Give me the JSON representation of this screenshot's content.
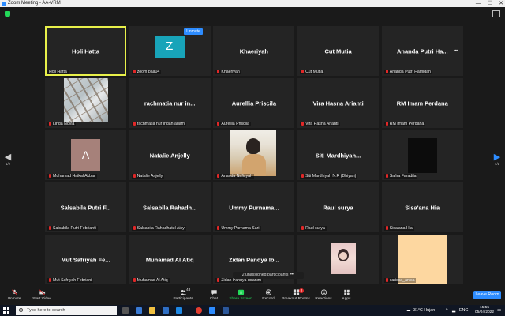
{
  "window": {
    "title": "Zoom Meeting - AA-VRM",
    "minimize": "—",
    "maximize": "☐",
    "close": "✕"
  },
  "security_icon": "shield-icon",
  "view_icon": "grid-view-icon",
  "tiles": [
    {
      "big": "Holi Hatta",
      "label": "Holi Hatta",
      "muted": false,
      "media": "none",
      "active": true
    },
    {
      "big": "",
      "label": "zoom baa04",
      "muted": true,
      "media": "avatar",
      "avatar_letter": "Z",
      "avatar_color": "#18a4b9",
      "badge": "Unmute"
    },
    {
      "big": "Khaeriyah",
      "label": "Khaeriyah",
      "muted": true,
      "media": "none"
    },
    {
      "big": "Cut Mutia",
      "label": "Cut Mutia",
      "muted": true,
      "media": "none"
    },
    {
      "big": "Ananda Putri Ha...",
      "label": "Ananda Putri Hamidah",
      "muted": true,
      "media": "none",
      "more": "•••"
    },
    {
      "big": "",
      "label": "Linda Novia",
      "muted": true,
      "media": "photo-skylight"
    },
    {
      "big": "rachmatia nur in...",
      "label": "rachmatia nur indah adam",
      "muted": true,
      "media": "none"
    },
    {
      "big": "Aurellia Priscila",
      "label": "Aurellia Priscila",
      "muted": true,
      "media": "none"
    },
    {
      "big": "Vira Hasna Arianti",
      "label": "Vira Hasna Arianti",
      "muted": true,
      "media": "none"
    },
    {
      "big": "RM Imam Perdana",
      "label": "RM Imam Perdana",
      "muted": true,
      "media": "none"
    },
    {
      "big": "",
      "label": "Muhamad Haikal Akbar",
      "muted": true,
      "media": "avatar-a",
      "avatar_letter": "A",
      "avatar_color": "#a6817a"
    },
    {
      "big": "Natalie Anjelly",
      "label": "Natalie Anjelly",
      "muted": true,
      "media": "none"
    },
    {
      "big": "",
      "label": "Ananda Nafisyah",
      "muted": true,
      "media": "photo-person"
    },
    {
      "big": "Siti Mardhiyah...",
      "label": "Siti Mardhiyah N.R (Dhiyah)",
      "muted": true,
      "media": "none"
    },
    {
      "big": "",
      "label": "Safira Faradila",
      "muted": true,
      "media": "photo-dark"
    },
    {
      "big": "Salsabila Putri F...",
      "label": "Salsabila Putri Febrianti",
      "muted": true,
      "media": "none"
    },
    {
      "big": "Salsabila Rahadh...",
      "label": "Salsabila Rahadhatul Aisy",
      "muted": true,
      "media": "none"
    },
    {
      "big": "Ummy Purnama...",
      "label": "Ummy Purnama Sari",
      "muted": true,
      "media": "none"
    },
    {
      "big": "Raul surya",
      "label": "Raul surya",
      "muted": true,
      "media": "none"
    },
    {
      "big": "Sisa'ana Hia",
      "label": "Sisa'ana Hia",
      "muted": true,
      "media": "none"
    },
    {
      "big": "Mut Safriyah Fe...",
      "label": "Mut Safriyah Febriani",
      "muted": true,
      "media": "none"
    },
    {
      "big": "Muhamad Al Atiq",
      "label": "Muhamad Al Atiq",
      "muted": true,
      "media": "none"
    },
    {
      "big": "Zidan Pandya Ib...",
      "label": "Zidan Pandya Ibrahim",
      "muted": true,
      "media": "none"
    },
    {
      "big": "",
      "label": "",
      "muted": false,
      "media": "photo-girl"
    },
    {
      "big": "",
      "label": "carissa_anisa",
      "muted": true,
      "media": "photo-peach"
    }
  ],
  "unassigned": {
    "text": "2 unassigned participants",
    "more": "•••"
  },
  "pager": {
    "left_page": "1/2",
    "right_page": "1/2",
    "left_arrow": "◀",
    "right_arrow": "▶"
  },
  "toolbar": {
    "unmute": "Unmute",
    "start_video": "Start Video",
    "participants": "Participants",
    "participants_count": "43",
    "chat": "Chat",
    "share_screen": "Share Screen",
    "record": "Record",
    "breakout_rooms": "Breakout Rooms",
    "breakout_badge": "2",
    "reactions": "Reactions",
    "apps": "Apps",
    "leave_room": "Leave Room",
    "share_color": "#23d959",
    "leave_color": "#2d8cff"
  },
  "taskbar": {
    "search_placeholder": "Type here to search",
    "weather": "31°C  Hujan",
    "lang": "ENG",
    "time": "15:55",
    "date": "05/04/2022"
  }
}
